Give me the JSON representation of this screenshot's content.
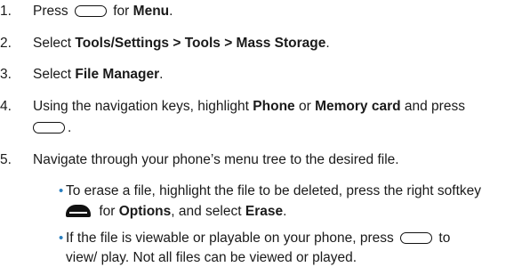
{
  "steps": [
    {
      "num": "1.",
      "pre": "Press",
      "post": "for",
      "bold": "Menu",
      "end": "."
    },
    {
      "num": "2.",
      "pre": "Select",
      "bold": "Tools/Settings > Tools > Mass Storage",
      "end": "."
    },
    {
      "num": "3.",
      "pre": "Select",
      "bold": "File Manager",
      "end": "."
    },
    {
      "num": "4.",
      "pre": "Using the navigation keys, highlight",
      "bold1": "Phone",
      "mid": "or",
      "bold2": "Memory card",
      "post": "and press",
      "end": "."
    },
    {
      "num": "5.",
      "text": "Navigate through your phone’s menu tree to the desired file."
    }
  ],
  "bullets": [
    {
      "pre": "To erase a file, highlight the file to be deleted, press the right softkey",
      "mid": "for",
      "bold1": "Options",
      "and": ", and select",
      "bold2": "Erase",
      "end": "."
    },
    {
      "pre": "If the file is viewable or playable on your phone, press",
      "post": "to",
      "line2": "view/ play. Not all files can be viewed or played."
    }
  ],
  "icons": {
    "menu_key": "oval-key-icon",
    "softkey": "right-softkey-icon"
  },
  "colors": {
    "bullet": "#2a7fc0",
    "text": "#1a1a1a"
  }
}
